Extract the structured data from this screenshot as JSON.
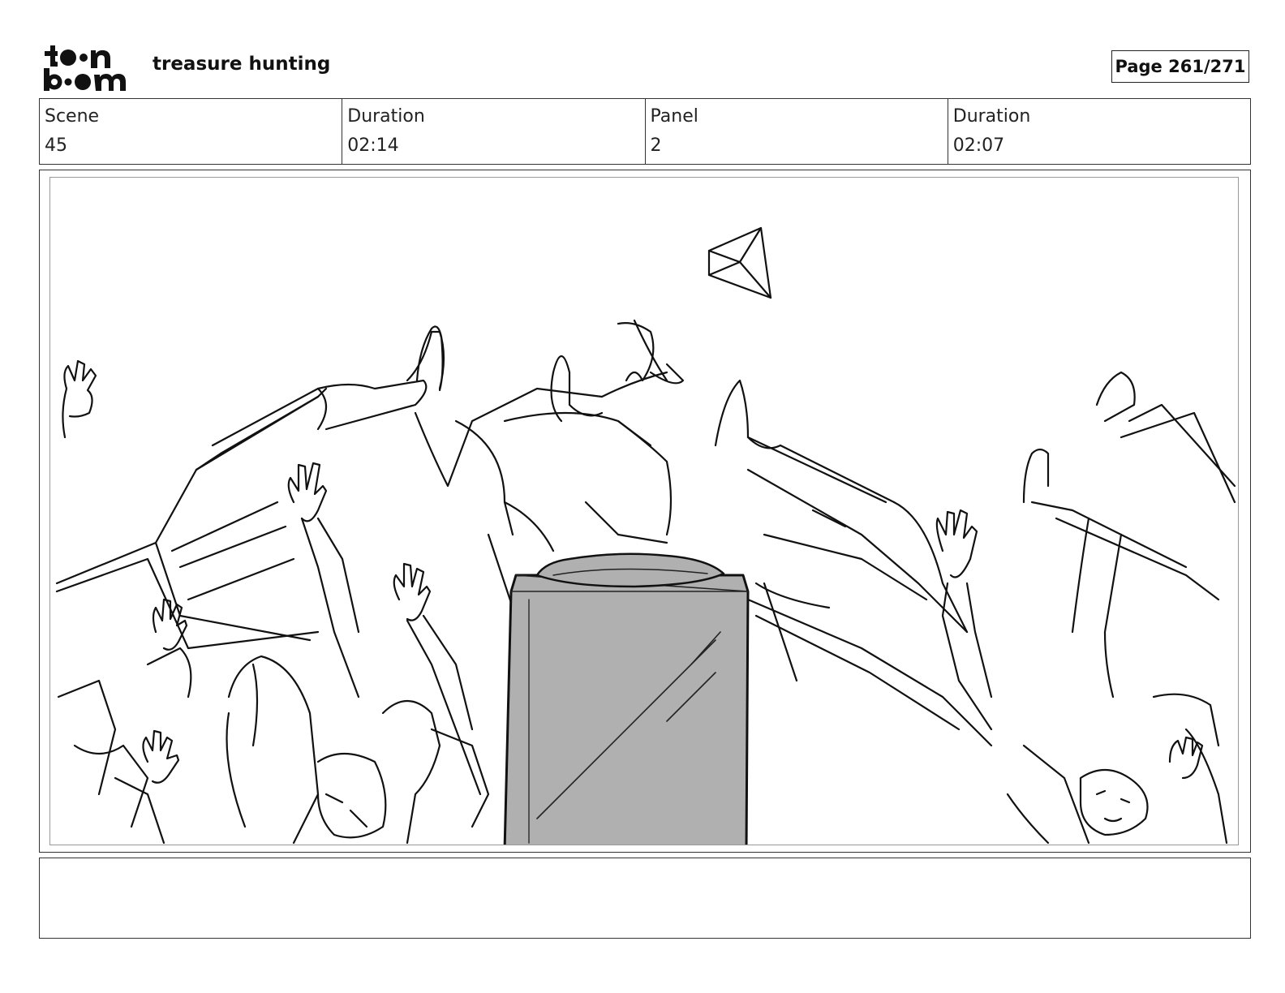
{
  "header": {
    "logo_line1": "toon",
    "logo_line2": "boom",
    "project_title": "treasure hunting",
    "page_label": "Page 261/271"
  },
  "info": {
    "scene_label": "Scene",
    "scene_value": "45",
    "scene_duration_label": "Duration",
    "scene_duration_value": "02:14",
    "panel_label": "Panel",
    "panel_value": "2",
    "panel_duration_label": "Duration",
    "panel_duration_value": "02:07"
  },
  "panel": {
    "image_name": "storyboard-sketch"
  },
  "notes": {
    "text": ""
  }
}
